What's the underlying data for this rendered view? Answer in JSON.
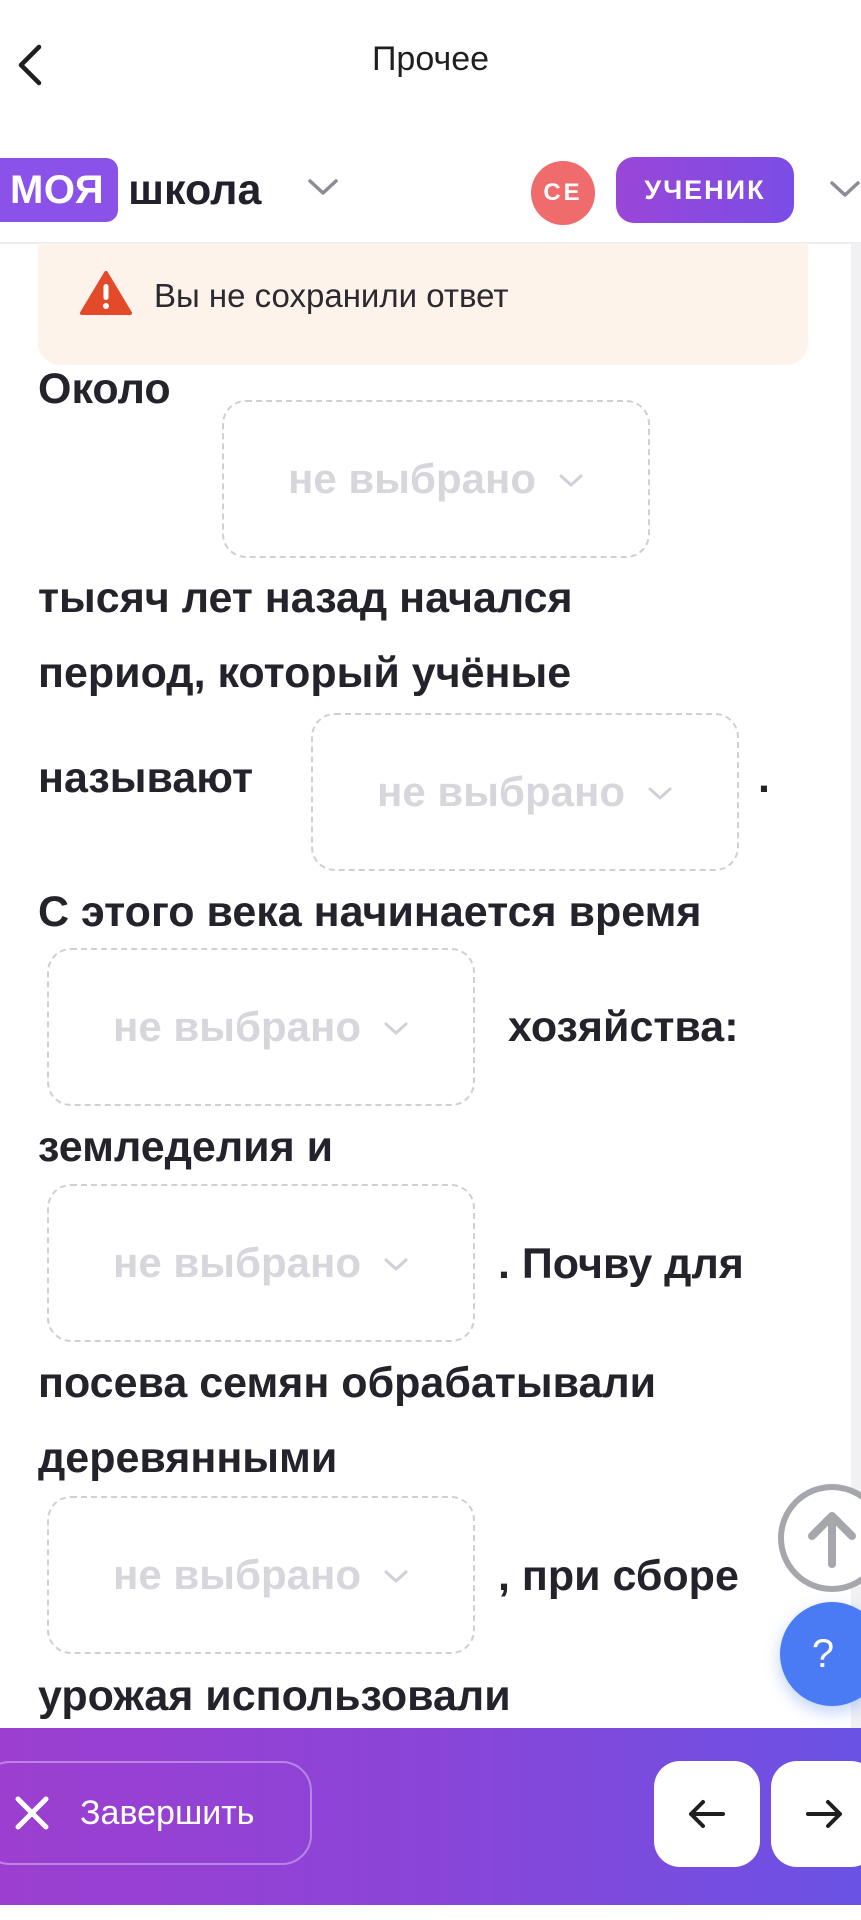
{
  "nav": {
    "title": "Прочее"
  },
  "school": {
    "brand_badge": "МОЯ",
    "brand_text": "школа",
    "avatar_initials": "СЕ",
    "role": "УЧЕНИК"
  },
  "warning": {
    "text": "Вы не сохранили ответ"
  },
  "exercise": {
    "placeholder": "не выбрано",
    "text": {
      "t1": "Около",
      "t2": "тысяч лет назад начался",
      "t3": "период, который учёные",
      "t4": "называют",
      "t5": ".",
      "t6": "С этого века начинается время",
      "t7": "хозяйства:",
      "t8": "земледелия и",
      "t9": ". Почву для",
      "t10": "посева семян обрабатывали",
      "t11": "деревянными",
      "t12": ", при сборе",
      "t13": "урожая использовали"
    }
  },
  "help": {
    "label": "?"
  },
  "bottom": {
    "finish_label": "Завершить"
  },
  "icons": {
    "back": "chevron-left-icon",
    "dropdown": "chevron-down-icon",
    "warning": "warning-triangle-icon",
    "scroll_up": "arrow-up-icon",
    "close": "close-icon",
    "prev": "arrow-left-icon",
    "next": "arrow-right-icon"
  },
  "colors": {
    "accent": "#8a52e8",
    "avatar": "#f06b6b",
    "warning_bg": "#fef3ea",
    "warning_icon": "#e24a2a",
    "help": "#4a7bf5"
  }
}
